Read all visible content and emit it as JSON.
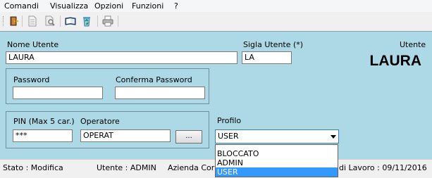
{
  "menu": {
    "items": [
      "Comandi",
      "Visualizza",
      "Opzioni",
      "Funzioni",
      "?"
    ]
  },
  "toolbar": {
    "icons": [
      "exit-door-icon",
      "document-icon",
      "search-icon",
      "open-book-icon",
      "recycle-bin-icon",
      "printer-icon"
    ]
  },
  "form": {
    "nome_utente_label": "Nome Utente",
    "nome_utente_value": "LAURA",
    "sigla_label": "Sigla Utente (*)",
    "sigla_value": "LA",
    "utente_caption": "Utente",
    "utente_display": "LAURA",
    "password_label": "Password",
    "password_value": "",
    "conferma_label": "Conferma Password",
    "conferma_value": "",
    "pin_label": "PIN (Max 5 car.)",
    "pin_value": "***",
    "operatore_label": "Operatore",
    "operatore_value": "OPERAT",
    "browse_label": "...",
    "profilo_label": "Profilo",
    "profilo_value": "USER"
  },
  "dropdown": {
    "options": [
      "BLOCCATO",
      "ADMIN",
      "USER"
    ],
    "selected": "USER"
  },
  "status": {
    "stato": "Stato : Modifica",
    "utente": "Utente : ADMIN",
    "azienda": "Azienda Corr",
    "data": "di Lavoro : 09/11/2016"
  },
  "colors": {
    "panel_bg": "#add8e6",
    "selection": "#3399ff"
  }
}
